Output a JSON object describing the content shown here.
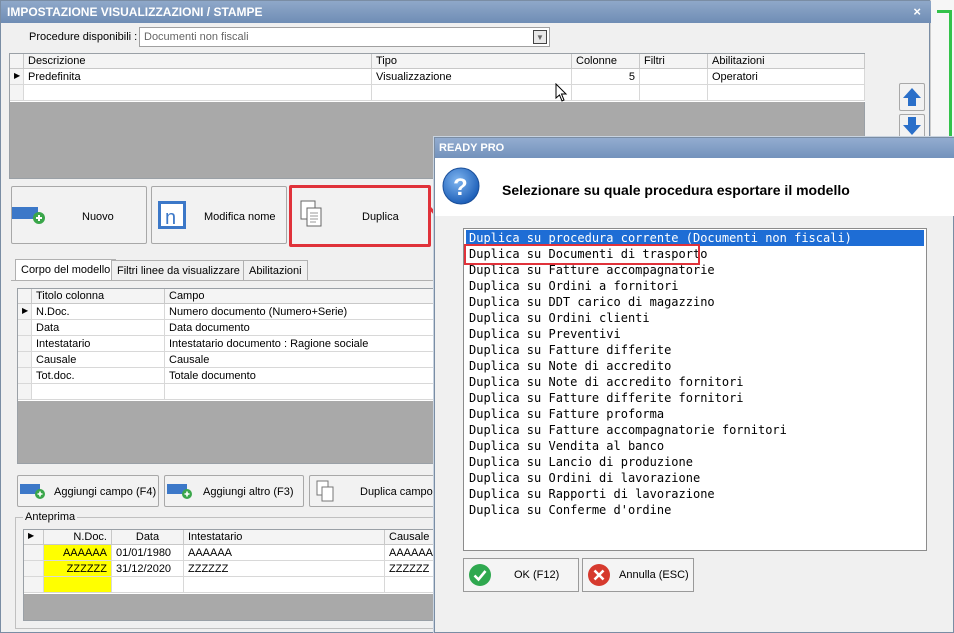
{
  "main": {
    "title": "IMPOSTAZIONE VISUALIZZAZIONI / STAMPE",
    "close": "×",
    "procedure_label": "Procedure disponibili :",
    "procedure_value": "Documenti non fiscali",
    "models_table": {
      "headers": [
        "Descrizione",
        "Tipo",
        "Colonne",
        "Filtri",
        "Abilitazioni"
      ],
      "rows": [
        {
          "descrizione": "Predefinita",
          "tipo": "Visualizzazione",
          "colonne": "5",
          "filtri": "",
          "abilitazioni": "Operatori"
        }
      ]
    },
    "buttons": {
      "nuovo": "Nuovo",
      "modifica_nome": "Modifica nome",
      "duplica": "Duplica",
      "aggiungi_campo": "Aggiungi campo (F4)",
      "aggiungi_altro": "Aggiungi altro (F3)",
      "duplica_campo": "Duplica campo"
    },
    "tabs": [
      "Corpo del modello",
      "Filtri linee da visualizzare",
      "Abilitazioni"
    ],
    "columns_table": {
      "headers": [
        "Titolo colonna",
        "Campo"
      ],
      "rows": [
        {
          "titolo": "N.Doc.",
          "campo": "Numero documento (Numero+Serie)"
        },
        {
          "titolo": "Data",
          "campo": "Data documento"
        },
        {
          "titolo": "Intestatario",
          "campo": "Intestatario documento : Ragione sociale"
        },
        {
          "titolo": "Causale",
          "campo": "Causale"
        },
        {
          "titolo": "Tot.doc.",
          "campo": "Totale documento"
        }
      ]
    },
    "preview": {
      "label": "Anteprima",
      "headers": [
        "N.Doc.",
        "Data",
        "Intestatario",
        "Causale"
      ],
      "rows": [
        {
          "ndoc": "AAAAAA",
          "data": "01/01/1980",
          "intestatario": "AAAAAA",
          "causale": "AAAAAA"
        },
        {
          "ndoc": "ZZZZZZ",
          "data": "31/12/2020",
          "intestatario": "ZZZZZZ",
          "causale": "ZZZZZZ"
        }
      ]
    }
  },
  "dialog": {
    "title": "READY PRO",
    "message": "Selezionare su quale procedura esportare il modello",
    "options": [
      "Duplica su procedura corrente (Documenti non fiscali)",
      "Duplica su Documenti di trasporto",
      "Duplica su Fatture accompagnatorie",
      "Duplica su Ordini a fornitori",
      "Duplica su DDT carico di magazzino",
      "Duplica su Ordini clienti",
      "Duplica su Preventivi",
      "Duplica su Fatture differite",
      "Duplica su Note di accredito",
      "Duplica su Note di accredito fornitori",
      "Duplica su Fatture differite fornitori",
      "Duplica su Fatture proforma",
      "Duplica su Fatture accompagnatorie fornitori",
      "Duplica su Vendita al banco",
      "Duplica su Lancio di produzione",
      "Duplica su Ordini di lavorazione",
      "Duplica su Rapporti di lavorazione",
      "Duplica su Conferme d'ordine"
    ],
    "ok_label": "OK (F12)",
    "cancel_label": "Annulla (ESC)"
  },
  "colors": {
    "title_bar": "#7392bc",
    "selection": "#1e6dd5",
    "highlight": "#e0323a",
    "preview_yellow": "#ffff00"
  }
}
